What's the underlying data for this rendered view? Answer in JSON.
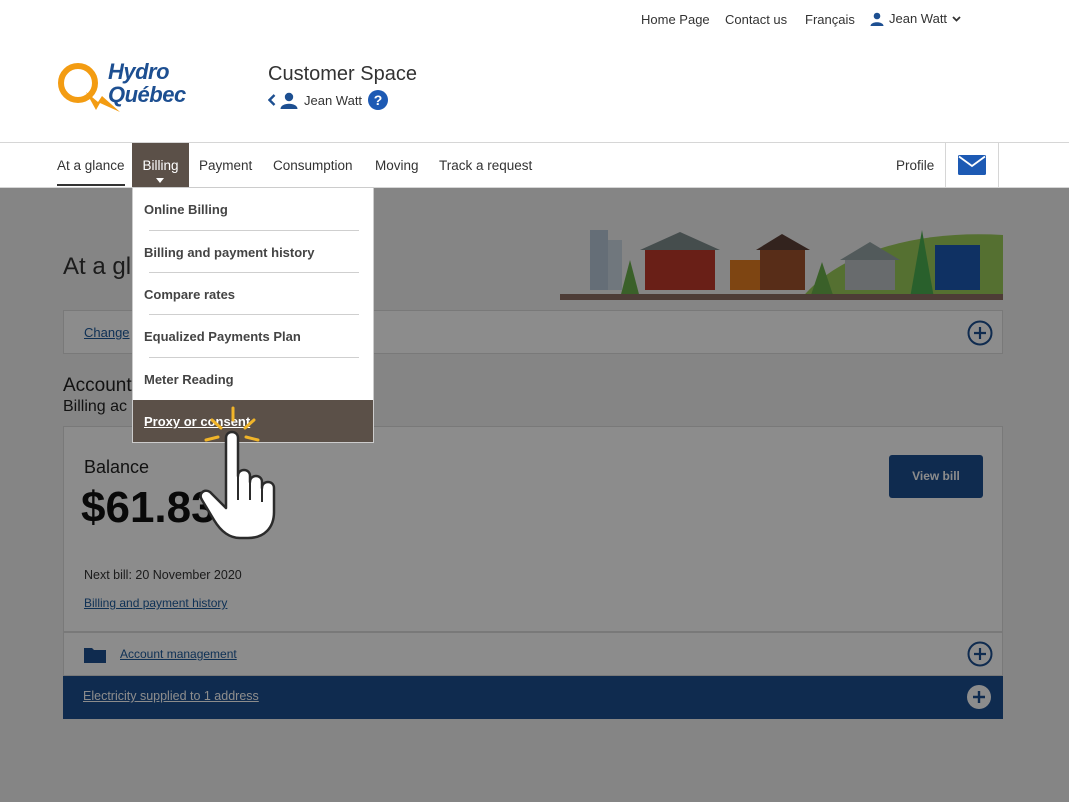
{
  "util": {
    "home": "Home Page",
    "contact": "Contact us",
    "language": "Français",
    "user": "Jean Watt"
  },
  "header": {
    "logo_line1": "Hydro",
    "logo_line2": "Québec",
    "title": "Customer Space",
    "account_name": "Jean Watt"
  },
  "nav": {
    "items": [
      "At a glance",
      "Billing",
      "Payment",
      "Consumption",
      "Moving",
      "Track a request"
    ],
    "profile": "Profile"
  },
  "dropdown": {
    "items": [
      "Online Billing",
      "Billing and payment history",
      "Compare rates",
      "Equalized Payments Plan",
      "Meter Reading",
      "Proxy or consent"
    ]
  },
  "main": {
    "page_title": "At a gl",
    "change_link": "Change",
    "account_heading": "Account",
    "billing_heading": "Billing ac",
    "balance_label": "Balance",
    "balance_value": "$61.83",
    "view_bill": "View bill",
    "next_bill": "Next bill: 20 November 2020",
    "history_link": "Billing and payment history",
    "account_management": "Account management",
    "electricity": "Electricity supplied to 1 address"
  },
  "colors": {
    "brand_blue": "#1d4f91",
    "logo_orange": "#f39c12",
    "nav_active": "#5b5048"
  }
}
